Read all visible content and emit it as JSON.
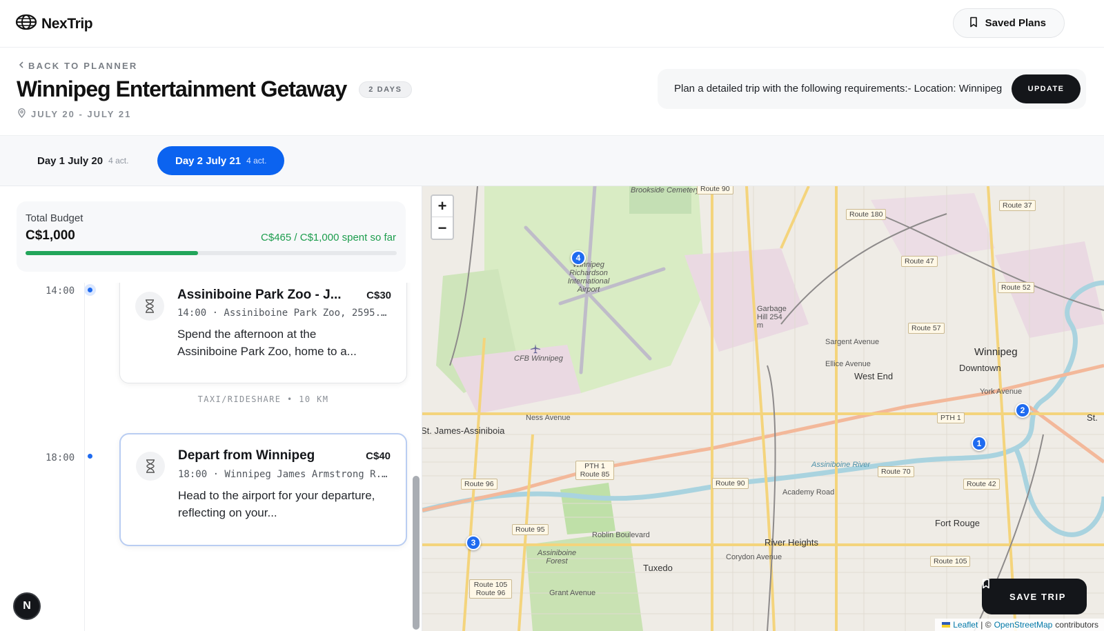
{
  "brand": {
    "name": "NexTrip",
    "icon": "globe-icon"
  },
  "topbar": {
    "saved_plans_label": "Saved Plans",
    "saved_icon": "bookmark-icon"
  },
  "header": {
    "back_label": "BACK TO PLANNER",
    "title": "Winnipeg Entertainment Getaway",
    "days_badge": "2 DAYS",
    "dates": "JULY 20 - JULY 21",
    "prompt_text": "Plan a detailed trip with the following requirements:- Location: Winnipeg",
    "update_label": "UPDATE"
  },
  "days": [
    {
      "label": "Day 1 July 20",
      "count": "4 act.",
      "selected": false
    },
    {
      "label": "Day 2 July 21",
      "count": "4 act.",
      "selected": true
    }
  ],
  "budget": {
    "label": "Total Budget",
    "total": "C$1,000",
    "spent_text": "C$465 / C$1,000 spent so far",
    "progress_fraction": 0.465,
    "bar_color": "#22a55a"
  },
  "activities": [
    {
      "time": "14:00",
      "title": "Assiniboine Park Zoo - J...",
      "price": "C$30",
      "subtitle": "14:00 · Assiniboine Park Zoo, 2595...",
      "description": "Spend the afternoon at the Assiniboine Park Zoo, home to a...",
      "icon": "hourglass-icon"
    },
    {
      "time": "18:00",
      "title": "Depart from Winnipeg",
      "price": "C$40",
      "subtitle": "18:00 · Winnipeg James Armstrong R...",
      "description": "Head to the airport for your departure, reflecting on your...",
      "icon": "hourglass-icon"
    }
  ],
  "transit": "TAXI/RIDESHARE • 10 KM",
  "avatar_letter": "N",
  "map": {
    "zoom_in": "+",
    "zoom_out": "−",
    "save_trip_label": "SAVE TRIP",
    "attribution": {
      "leaflet": "Leaflet",
      "sep": " | © ",
      "osm": "OpenStreetMap",
      "suffix": "contributors"
    },
    "pins": [
      "1",
      "2",
      "3",
      "4"
    ],
    "labels": {
      "winnipeg": "Winnipeg",
      "downtown": "Downtown",
      "west_end": "West End",
      "st_james": "St. James-Assiniboia",
      "river_heights": "River Heights",
      "tuxedo": "Tuxedo",
      "fort_rouge": "Fort Rouge",
      "st": "St.",
      "airport": "Winnipeg Richardson International Airport",
      "cfb": "CFB Winnipeg",
      "forest": "Assiniboine Forest",
      "cemetery": "Brookside Cemetery",
      "garbage_hill": "Garbage Hill 254 m",
      "ness_avenue": "Ness Avenue",
      "academy_road": "Academy Road",
      "grant_avenue": "Grant Avenue",
      "corydon_avenue": "Corydon Avenue",
      "roblin_boulevard": "Roblin Boulevard",
      "assiniboine_river": "Assiniboine River",
      "sargent_avenue": "Sargent Avenue",
      "ellice_avenue": "Ellice Avenue",
      "york_avenue": "York Avenue"
    },
    "shields": {
      "r180": "Route 180",
      "r37": "Route 37",
      "r47": "Route 47",
      "r52": "Route 52",
      "r57": "Route 57",
      "pth1_top": "PTH 1",
      "pth1_85": "PTH 1 Route 85",
      "r96": "Route 96",
      "r90": "Route 90",
      "r70": "Route 70",
      "r42": "Route 42",
      "r95": "Route 95",
      "r105": "Route 105",
      "r105_96": "Route 105 Route 96",
      "r90_top": "Route 90"
    }
  }
}
